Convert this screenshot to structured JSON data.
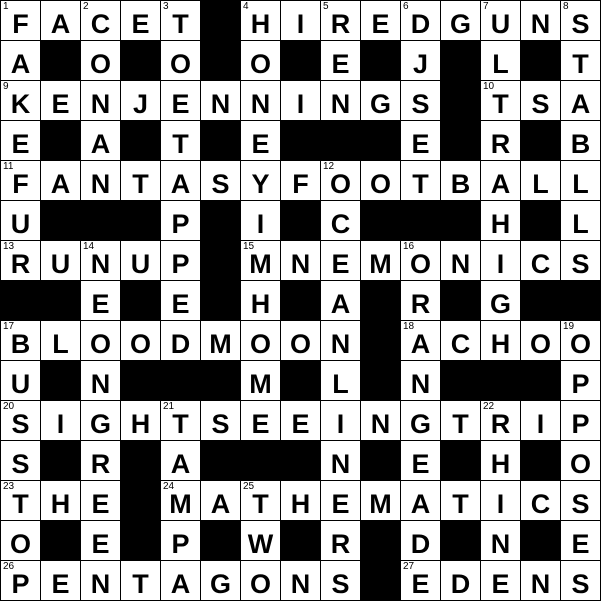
{
  "puzzle": {
    "rows": [
      "FACET#HIREDGUNS",
      "A#O#O#O#E#J#L#T",
      "KENJENNINGS#TSA",
      "E#A#T#E###E#R#B",
      "FANTASYFOOTBALL",
      "U###P#I#C###H#L",
      "RUNUP#MNEMONICS",
      "##E#E#H#A#R#G##",
      "BLOODMOON#ACHOO",
      "U#N###M#L#N###P",
      "SIGHTSEEINGTRIP",
      "S#R#A###N#E#H#O",
      "THE#MATHEMATICS",
      "O#E#P#W#R#D#N#E",
      "PENTAGONS#EDENS"
    ],
    "numbers": [
      [
        1,
        0,
        2,
        0,
        3,
        0,
        4,
        0,
        5,
        0,
        6,
        0,
        7,
        0,
        8
      ],
      [
        0,
        0,
        0,
        0,
        0,
        0,
        0,
        0,
        0,
        0,
        0,
        0,
        0,
        0,
        0
      ],
      [
        9,
        0,
        0,
        0,
        0,
        0,
        0,
        0,
        0,
        0,
        0,
        0,
        10,
        0,
        0
      ],
      [
        0,
        0,
        0,
        0,
        0,
        0,
        0,
        0,
        0,
        0,
        0,
        0,
        0,
        0,
        0
      ],
      [
        11,
        0,
        0,
        0,
        0,
        0,
        0,
        0,
        12,
        0,
        0,
        0,
        0,
        0,
        0
      ],
      [
        0,
        0,
        0,
        0,
        0,
        0,
        0,
        0,
        0,
        0,
        0,
        0,
        0,
        0,
        0
      ],
      [
        13,
        0,
        14,
        0,
        0,
        0,
        15,
        0,
        0,
        0,
        16,
        0,
        0,
        0,
        0
      ],
      [
        0,
        0,
        0,
        0,
        0,
        0,
        0,
        0,
        0,
        0,
        0,
        0,
        0,
        0,
        0
      ],
      [
        17,
        0,
        0,
        0,
        0,
        0,
        0,
        0,
        0,
        0,
        18,
        0,
        0,
        0,
        19
      ],
      [
        0,
        0,
        0,
        0,
        0,
        0,
        0,
        0,
        0,
        0,
        0,
        0,
        0,
        0,
        0
      ],
      [
        20,
        0,
        0,
        0,
        21,
        0,
        0,
        0,
        0,
        0,
        0,
        0,
        22,
        0,
        0
      ],
      [
        0,
        0,
        0,
        0,
        0,
        0,
        0,
        0,
        0,
        0,
        0,
        0,
        0,
        0,
        0
      ],
      [
        23,
        0,
        0,
        0,
        24,
        0,
        25,
        0,
        0,
        0,
        0,
        0,
        0,
        0,
        0
      ],
      [
        0,
        0,
        0,
        0,
        0,
        0,
        0,
        0,
        0,
        0,
        0,
        0,
        0,
        0,
        0
      ],
      [
        26,
        0,
        0,
        0,
        0,
        0,
        0,
        0,
        0,
        0,
        27,
        0,
        0,
        0,
        0
      ]
    ],
    "colors": {
      "block": "#000000",
      "cell": "#ffffff",
      "text": "#000000"
    }
  }
}
